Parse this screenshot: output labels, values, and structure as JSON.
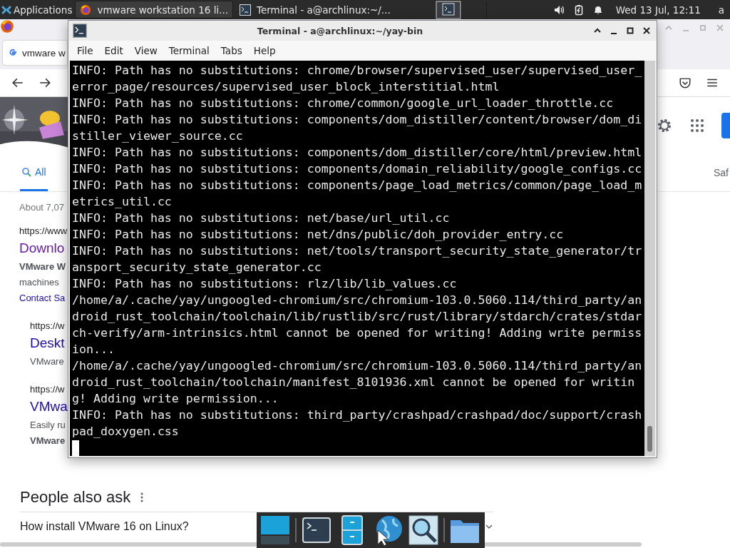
{
  "taskbar": {
    "apps_menu": "Applications",
    "tasks": [
      {
        "label": "vmware workstation 16 li...",
        "kind": "browser",
        "selected": true
      },
      {
        "label": "Terminal - a@archlinux:~/...",
        "kind": "terminal",
        "selected": false
      }
    ],
    "clock": "Wed 13 Jul, 12:11",
    "user": "a"
  },
  "browser": {
    "tab_title": "vmware w",
    "search_tabs": [
      {
        "label": "All",
        "selected": true
      }
    ],
    "search_tab_right": "Saf",
    "result_count": "About 7,07",
    "results": [
      {
        "url": "https://www",
        "title": "Downlo",
        "visited": true,
        "lines": [
          {
            "text": "VMware W",
            "bold": true
          },
          {
            "text": "machines",
            "bold": false
          }
        ],
        "link": "Contact Sa",
        "nested": false
      },
      {
        "url": "https://w",
        "title": "Deskt",
        "visited": false,
        "lines": [
          {
            "text": "VMware",
            "bold": false
          }
        ],
        "nested": true
      },
      {
        "url": "https://w",
        "title": "VMwa",
        "visited": false,
        "lines": [
          {
            "text": "Easily ru",
            "bold": false
          },
          {
            "text": "VMware",
            "bold": true
          }
        ],
        "nested": true
      }
    ],
    "people_also_ask": {
      "heading": "People also ask",
      "questions": [
        "How install VMware 16 on Linux?"
      ]
    }
  },
  "terminal": {
    "title": "Terminal - a@archlinux:~/yay-bin",
    "menu": [
      "File",
      "Edit",
      "View",
      "Terminal",
      "Tabs",
      "Help"
    ],
    "output": [
      "INFO: Path has no substitutions: chrome/browser/supervised_user/supervised_user_error_page/resources/supervised_user_block_interstitial.html",
      "INFO: Path has no substitutions: chrome/common/google_url_loader_throttle.cc",
      "INFO: Path has no substitutions: components/dom_distiller/content/browser/dom_distiller_viewer_source.cc",
      "INFO: Path has no substitutions: components/dom_distiller/core/html/preview.html",
      "INFO: Path has no substitutions: components/domain_reliability/google_configs.cc",
      "INFO: Path has no substitutions: components/page_load_metrics/common/page_load_metrics_util.cc",
      "INFO: Path has no substitutions: net/base/url_util.cc",
      "INFO: Path has no substitutions: net/dns/public/doh_provider_entry.cc",
      "INFO: Path has no substitutions: net/tools/transport_security_state_generator/transport_security_state_generator.cc",
      "INFO: Path has no substitutions: rlz/lib/lib_values.cc",
      "/home/a/.cache/yay/ungoogled-chromium/src/chromium-103.0.5060.114/third_party/android_rust_toolchain/toolchain/lib/rustlib/src/rust/library/stdarch/crates/stdarch-verify/arm-intrinsics.html cannot be opened for writing! Adding write permission...",
      "/home/a/.cache/yay/ungoogled-chromium/src/chromium-103.0.5060.114/third_party/android_rust_toolchain/toolchain/manifest_8101936.xml cannot be opened for writing! Adding write permission...",
      "INFO: Path has no substitutions: third_party/crashpad/crashpad/doc/support/crashpad_doxygen.css"
    ]
  }
}
